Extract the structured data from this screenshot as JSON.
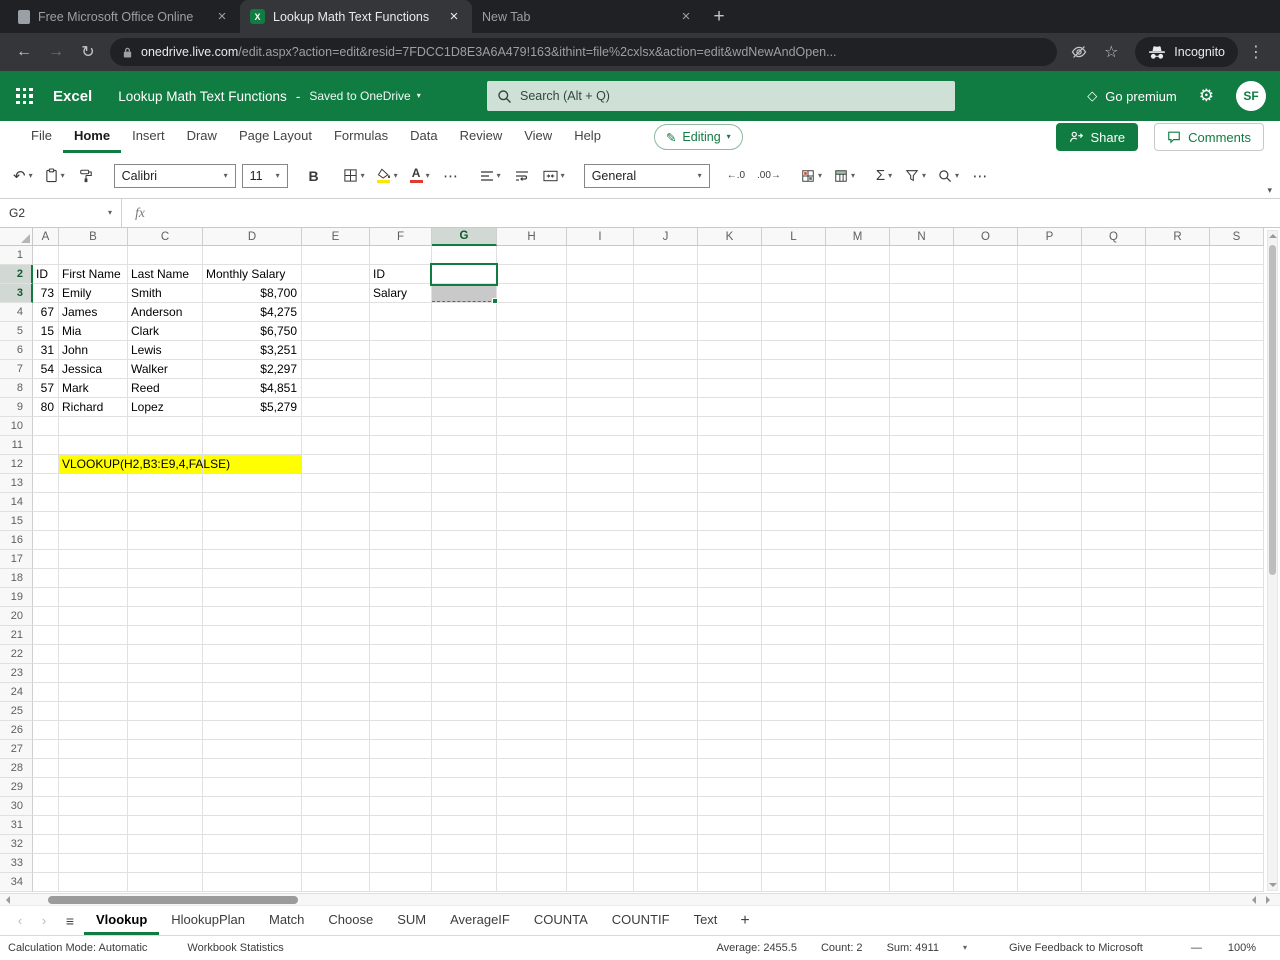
{
  "browser": {
    "tabs": [
      {
        "title": "Free Microsoft Office Online",
        "active": false
      },
      {
        "title": "Lookup Math Text Functions",
        "active": true
      },
      {
        "title": "New Tab",
        "active": false
      }
    ],
    "url_domain": "onedrive.live.com",
    "url_path": "/edit.aspx?action=edit&resid=7FDCC1D8E3A6A479!163&ithint=file%2cxlsx&action=edit&wdNewAndOpen...",
    "incognito_label": "Incognito"
  },
  "app_header": {
    "app_name": "Excel",
    "doc_title": "Lookup Math Text Functions",
    "separator": "-",
    "saved_status": "Saved to OneDrive",
    "search_placeholder": "Search (Alt + Q)",
    "go_premium_label": "Go premium",
    "avatar_initials": "SF"
  },
  "menu": {
    "items": [
      "File",
      "Home",
      "Insert",
      "Draw",
      "Page Layout",
      "Formulas",
      "Data",
      "Review",
      "View",
      "Help"
    ],
    "active": "Home",
    "editing_label": "Editing",
    "share_label": "Share",
    "comments_label": "Comments"
  },
  "toolbar": {
    "font_name": "Calibri",
    "font_size": "11",
    "number_format": "General"
  },
  "formula_bar": {
    "name_box": "G2",
    "fx_label": "fx",
    "formula": ""
  },
  "grid": {
    "columns": [
      "A",
      "B",
      "C",
      "D",
      "E",
      "F",
      "G",
      "H",
      "I",
      "J",
      "K",
      "L",
      "M",
      "N",
      "O",
      "P",
      "Q",
      "R",
      "S"
    ],
    "row_count": 34,
    "selected_column": "G",
    "selected_row_headers": [
      2,
      3
    ],
    "active_cell": "G2",
    "cells": [
      {
        "ref": "A2",
        "v": "ID"
      },
      {
        "ref": "B2",
        "v": "First Name"
      },
      {
        "ref": "C2",
        "v": "Last Name"
      },
      {
        "ref": "D2",
        "v": "Monthly Salary"
      },
      {
        "ref": "F2",
        "v": "ID"
      },
      {
        "ref": "A3",
        "v": "73",
        "num": true
      },
      {
        "ref": "B3",
        "v": "Emily"
      },
      {
        "ref": "C3",
        "v": "Smith"
      },
      {
        "ref": "D3",
        "v": "$8,700",
        "num": true
      },
      {
        "ref": "F3",
        "v": "Salary"
      },
      {
        "ref": "A4",
        "v": "67",
        "num": true
      },
      {
        "ref": "B4",
        "v": "James"
      },
      {
        "ref": "C4",
        "v": "Anderson"
      },
      {
        "ref": "D4",
        "v": "$4,275",
        "num": true
      },
      {
        "ref": "A5",
        "v": "15",
        "num": true
      },
      {
        "ref": "B5",
        "v": "Mia"
      },
      {
        "ref": "C5",
        "v": "Clark"
      },
      {
        "ref": "D5",
        "v": "$6,750",
        "num": true
      },
      {
        "ref": "A6",
        "v": "31",
        "num": true
      },
      {
        "ref": "B6",
        "v": "John"
      },
      {
        "ref": "C6",
        "v": "Lewis"
      },
      {
        "ref": "D6",
        "v": "$3,251",
        "num": true
      },
      {
        "ref": "A7",
        "v": "54",
        "num": true
      },
      {
        "ref": "B7",
        "v": "Jessica"
      },
      {
        "ref": "C7",
        "v": "Walker"
      },
      {
        "ref": "D7",
        "v": "$2,297",
        "num": true
      },
      {
        "ref": "A8",
        "v": "57",
        "num": true
      },
      {
        "ref": "B8",
        "v": "Mark"
      },
      {
        "ref": "C8",
        "v": "Reed"
      },
      {
        "ref": "D8",
        "v": "$4,851",
        "num": true
      },
      {
        "ref": "A9",
        "v": "80",
        "num": true
      },
      {
        "ref": "B9",
        "v": "Richard"
      },
      {
        "ref": "C9",
        "v": "Lopez"
      },
      {
        "ref": "D9",
        "v": "$5,279",
        "num": true
      },
      {
        "ref": "B12",
        "v": "VLOOKUP(H2,B3:E9,4,FALSE)",
        "highlight": "yellow",
        "spill": true
      },
      {
        "ref": "C12",
        "v": "",
        "highlight": "yellow"
      },
      {
        "ref": "D12",
        "v": "",
        "highlight": "yellow"
      }
    ]
  },
  "sheet_tabs": {
    "tabs": [
      "Vlookup",
      "HlookupPlan",
      "Match",
      "Choose",
      "SUM",
      "AverageIF",
      "COUNTA",
      "COUNTIF",
      "Text"
    ],
    "active": "Vlookup"
  },
  "status_bar": {
    "calc_mode": "Calculation Mode: Automatic",
    "workbook_stats": "Workbook Statistics",
    "average": "Average: 2455.5",
    "count": "Count: 2",
    "sum": "Sum: 4911",
    "feedback": "Give Feedback to Microsoft",
    "zoom": "100%"
  },
  "colors": {
    "excel_green": "#107c41",
    "selection_gray": "#c9c9c9",
    "note_yellow": "#ffff00",
    "font_color_red": "#e03c31",
    "fill_color_yellow": "#ffe400"
  }
}
